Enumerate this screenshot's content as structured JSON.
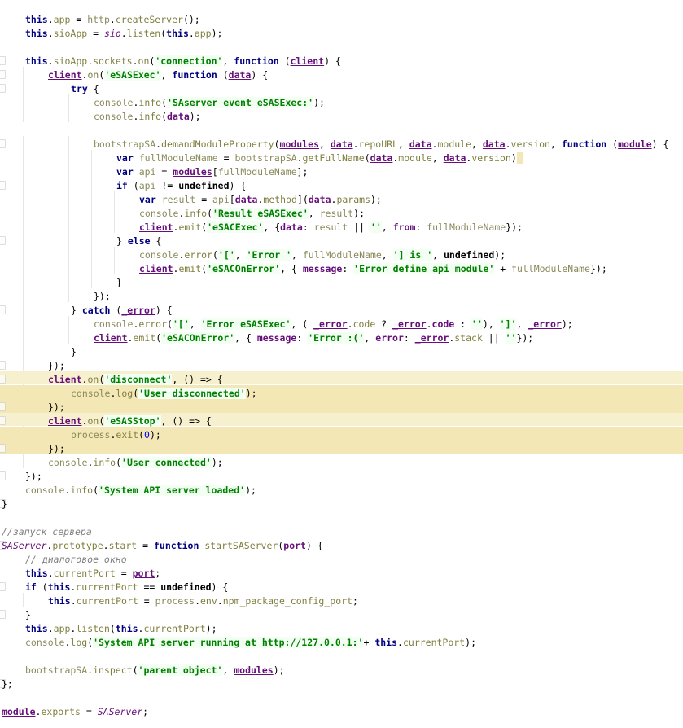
{
  "editor": {
    "app": "code-editor",
    "language": "JavaScript",
    "font_size_px": 11.5,
    "line_height_px": 17,
    "colors": {
      "background": "#ffffff",
      "keyword": "#000080",
      "string": "#008000",
      "string_bg": "#f2fff2",
      "comment": "#808080",
      "function": "#7f7f3f",
      "identifier": "#8a8a5c",
      "property": "#660e7a",
      "number": "#0000ff",
      "highlight_band": "#f2e7b5",
      "indent_guide": "#e6e6e6",
      "caret_block": "#f2e7b5"
    },
    "caret": {
      "present": true,
      "line_index": 10,
      "after_text": "data.version)"
    },
    "highlighted_lines": [
      27,
      28,
      30,
      31
    ]
  },
  "lines": [
    {
      "n": 0,
      "indent": 1,
      "text": "this.app = http.createServer();"
    },
    {
      "n": 1,
      "indent": 1,
      "text": "this.sioApp = sio.listen(this.app);"
    },
    {
      "n": 2,
      "indent": 0,
      "text": ""
    },
    {
      "n": 3,
      "indent": 1,
      "text": "this.sioApp.sockets.on('connection', function (client) {"
    },
    {
      "n": 4,
      "indent": 2,
      "text": "client.on('eSASExec', function (data) {"
    },
    {
      "n": 5,
      "indent": 3,
      "text": "try {"
    },
    {
      "n": 6,
      "indent": 4,
      "text": "console.info('SAserver event eSASExec:');"
    },
    {
      "n": 7,
      "indent": 4,
      "text": "console.info(data);"
    },
    {
      "n": 8,
      "indent": 0,
      "text": ""
    },
    {
      "n": 9,
      "indent": 4,
      "text": "bootstrapSA.demandModuleProperty(modules, data.repoURL, data.module, data.version, function (module) {"
    },
    {
      "n": 10,
      "indent": 5,
      "text": "var fullModuleName = bootstrapSA.getFullName(data.module, data.version)"
    },
    {
      "n": 11,
      "indent": 5,
      "text": "var api = modules[fullModuleName];"
    },
    {
      "n": 12,
      "indent": 5,
      "text": "if (api != undefined) {"
    },
    {
      "n": 13,
      "indent": 6,
      "text": "var result = api[data.method](data.params);"
    },
    {
      "n": 14,
      "indent": 6,
      "text": "console.info('Result eSASExec', result);"
    },
    {
      "n": 15,
      "indent": 6,
      "text": "client.emit('eSACExec', {data: result || '', from: fullModuleName});"
    },
    {
      "n": 16,
      "indent": 5,
      "text": "} else {"
    },
    {
      "n": 17,
      "indent": 6,
      "text": "console.error('[', 'Error ', fullModuleName, '] is ', undefined);"
    },
    {
      "n": 18,
      "indent": 6,
      "text": "client.emit('eSACOnError', { message: 'Error define api module' + fullModuleName});"
    },
    {
      "n": 19,
      "indent": 5,
      "text": "}"
    },
    {
      "n": 20,
      "indent": 4,
      "text": "});"
    },
    {
      "n": 21,
      "indent": 3,
      "text": "} catch (_error) {"
    },
    {
      "n": 22,
      "indent": 4,
      "text": "console.error('[', 'Error eSASExec', ( _error.code ? _error.code : ''), ']', _error);"
    },
    {
      "n": 23,
      "indent": 4,
      "text": "client.emit('eSACOnError', { message: 'Error :(', error: _error.stack || ''});"
    },
    {
      "n": 24,
      "indent": 3,
      "text": "}"
    },
    {
      "n": 25,
      "indent": 2,
      "text": "});"
    },
    {
      "n": 26,
      "indent": 2,
      "text": "client.on('disconnect', () => {"
    },
    {
      "n": 27,
      "indent": 3,
      "text": "console.log('User disconnected');"
    },
    {
      "n": 28,
      "indent": 2,
      "text": "});"
    },
    {
      "n": 29,
      "indent": 2,
      "text": "client.on('eSASStop', () => {"
    },
    {
      "n": 30,
      "indent": 3,
      "text": "process.exit(0);"
    },
    {
      "n": 31,
      "indent": 2,
      "text": "});"
    },
    {
      "n": 32,
      "indent": 2,
      "text": "console.info('User connected');"
    },
    {
      "n": 33,
      "indent": 1,
      "text": "});"
    },
    {
      "n": 34,
      "indent": 1,
      "text": "console.info('System API server loaded');"
    },
    {
      "n": 35,
      "indent": 0,
      "text": "}"
    },
    {
      "n": 36,
      "indent": 0,
      "text": ""
    },
    {
      "n": 37,
      "indent": 0,
      "text": "//запуск сервера"
    },
    {
      "n": 38,
      "indent": 0,
      "text": "SAServer.prototype.start = function startSAServer(port) {"
    },
    {
      "n": 39,
      "indent": 1,
      "text": "// диалоговое окно"
    },
    {
      "n": 40,
      "indent": 1,
      "text": "this.currentPort = port;"
    },
    {
      "n": 41,
      "indent": 1,
      "text": "if (this.currentPort == undefined) {"
    },
    {
      "n": 42,
      "indent": 2,
      "text": "this.currentPort = process.env.npm_package_config_port;"
    },
    {
      "n": 43,
      "indent": 1,
      "text": "}"
    },
    {
      "n": 44,
      "indent": 1,
      "text": "this.app.listen(this.currentPort);"
    },
    {
      "n": 45,
      "indent": 1,
      "text": "console.log('System API server running at http://127.0.0.1:'+ this.currentPort);"
    },
    {
      "n": 46,
      "indent": 0,
      "text": ""
    },
    {
      "n": 47,
      "indent": 1,
      "text": "bootstrapSA.inspect('parent object', modules);"
    },
    {
      "n": 48,
      "indent": 0,
      "text": "};"
    },
    {
      "n": 49,
      "indent": 0,
      "text": ""
    },
    {
      "n": 50,
      "indent": 0,
      "text": "module.exports = SAServer;"
    }
  ],
  "comments": {
    "startup": "//запуск сервера",
    "dialog": "// диалоговое окно"
  },
  "strings": [
    "'connection'",
    "'eSASExec'",
    "'SAserver event eSASExec:'",
    "'Result eSASExec'",
    "'eSACExec'",
    "'Error '",
    "'] is '",
    "'eSACOnError'",
    "'Error define api module'",
    "'Error eSASExec'",
    "'[' ",
    "']'",
    "'Error :('",
    "'disconnect'",
    "'User disconnected'",
    "'eSASStop'",
    "'User connected'",
    "'System API server loaded'",
    "'System API server running at http://127.0.0.1:'",
    "'parent object'"
  ],
  "gutter": {
    "fold_marker_rows": [
      3,
      4,
      5,
      9,
      12,
      16,
      21,
      25,
      26,
      28,
      29,
      31,
      33,
      35,
      38,
      41,
      43,
      48
    ]
  }
}
